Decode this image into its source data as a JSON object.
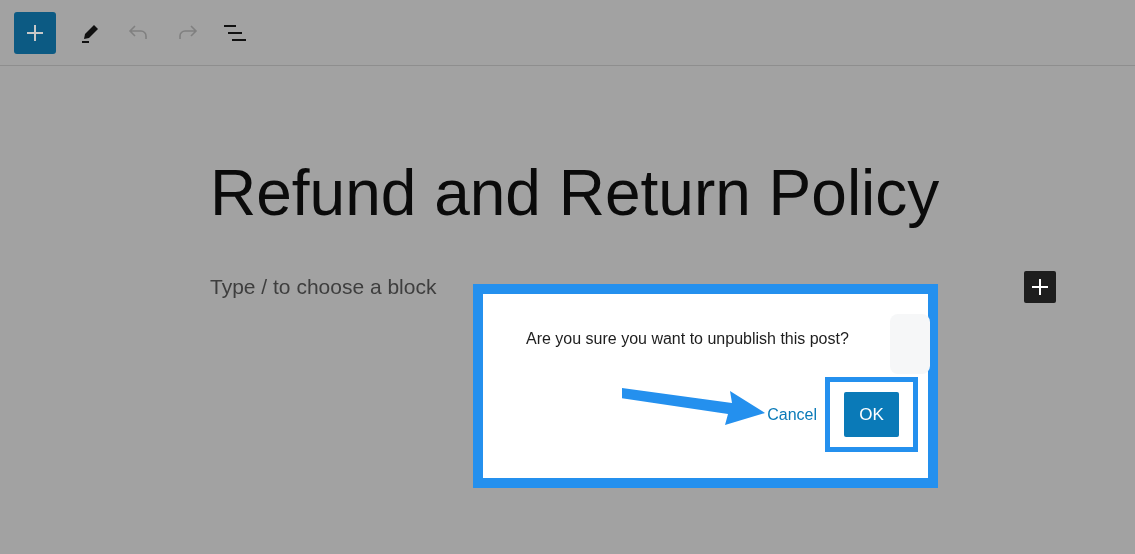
{
  "toolbar": [
    {
      "kind": "add",
      "disabled": false
    },
    {
      "kind": "edit",
      "disabled": false
    },
    {
      "kind": "undo",
      "disabled": true
    },
    {
      "kind": "redo",
      "disabled": true
    },
    {
      "kind": "outline",
      "disabled": false
    }
  ],
  "editor": {
    "title": "Refund and Return Policy",
    "placeholder": "Type / to choose a block"
  },
  "dialog": {
    "message": "Are you sure you want to unpublish this post?",
    "cancel": "Cancel",
    "ok": "OK"
  }
}
